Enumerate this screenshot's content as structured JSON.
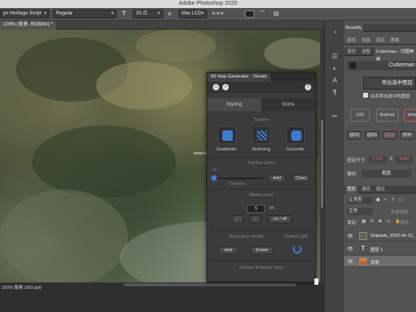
{
  "app_title": "Adobe Photoshop 2020",
  "options_bar": {
    "font_family": "yn Heritage Script",
    "font_style": "Regular",
    "type_icon": "T",
    "font_size": "20 点",
    "aa_label": "a",
    "aa_mode": "Mac LCD"
  },
  "document": {
    "tab": "100% (背景, RGB/8#) *",
    "zoom_status": "100%",
    "status_info": "像素 (300 ppi)"
  },
  "watermark": "www.MacDown.com",
  "plugin": {
    "title": "3D Map Generator - Terrain",
    "help": "?",
    "tabs": [
      "Styling",
      "Icons"
    ],
    "surface_label": "Surface",
    "surface_buttons": [
      "Gradients",
      "Texturing",
      "Grounds"
    ],
    "contour_label": "Contour Lines",
    "contour_value": "10",
    "distance_label": "Distance",
    "add": "Add",
    "clear": "Clear",
    "water_label": "Water Level",
    "water_value": "5",
    "water_unit": "px",
    "on_off": "on / off",
    "map_layer_label": "Map Layer Height",
    "global_light_label": "Global Light",
    "add2": "Add",
    "delete": "Delete",
    "surface_drawing": "Surface Drawing Tools"
  },
  "beautify": {
    "tab": "Beautify",
    "row1": [
      "颜色",
      "色板",
      "渐变",
      "图案"
    ],
    "row2": [
      "属性",
      "调整",
      "Cutterman - 切图神器"
    ],
    "brand": "Cutterman",
    "export_btn": "导出选中图层",
    "merge_label": "合并导出选中的图层",
    "platforms": [
      "iOS",
      "Android",
      "Web"
    ],
    "scales": [
      "@3X",
      "@2X",
      "@1X",
      "PDF"
    ],
    "fixed_size_label": "固定尺寸",
    "fixed_w": "1770",
    "fixed_x": "X",
    "fixed_h": "1000",
    "output_label": "输出",
    "output_value": "截图"
  },
  "layers_panel": {
    "tabs": [
      "图层",
      "通道",
      "路径"
    ],
    "filter": "Q 类型",
    "blend": "正常",
    "opacity_label": "不透明度",
    "lock_label": "锁定:",
    "fill_label": "填充",
    "layers": [
      {
        "name": "Snipaste_2020-04-13_",
        "selected": false
      },
      {
        "name": "图层 1",
        "selected": false
      },
      {
        "name": "背景",
        "selected": true
      }
    ]
  },
  "colors": {
    "accent_blue": "#3f7ad1",
    "panel_bg": "#535353",
    "web_border": "#d9534f"
  }
}
